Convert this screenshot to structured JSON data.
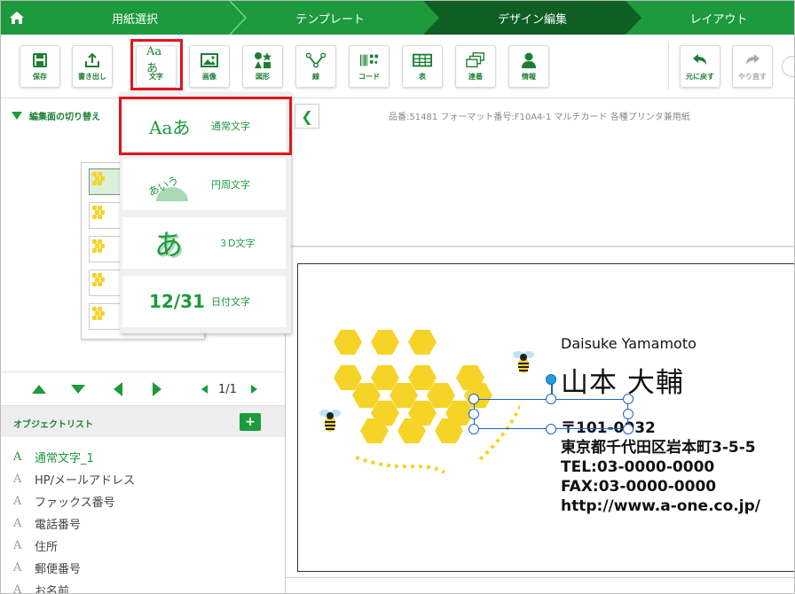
{
  "steps": [
    {
      "label": "用紙選択"
    },
    {
      "label": "テンプレート"
    },
    {
      "label": "デザイン編集"
    },
    {
      "label": "レイアウト"
    }
  ],
  "toolbar": {
    "save": "保存",
    "export": "書き出し",
    "text": "文字",
    "text_icon": "Aaあ",
    "image": "画像",
    "shape": "図形",
    "line": "線",
    "code": "コード",
    "table": "表",
    "serial": "連番",
    "info": "情報",
    "undo": "元に戻す",
    "redo": "やり直す"
  },
  "left": {
    "switch_label": "編集面の切り替え",
    "page_indicator": "1/1",
    "object_list_title": "オブジェクトリスト",
    "objects": [
      {
        "label": "通常文字_1",
        "active": true
      },
      {
        "label": "HP/メールアドレス"
      },
      {
        "label": "ファックス番号"
      },
      {
        "label": "電話番号"
      },
      {
        "label": "住所"
      },
      {
        "label": "郵便番号"
      },
      {
        "label": "お名前"
      }
    ]
  },
  "dropdown": {
    "normal": {
      "icon": "Aaあ",
      "label": "通常文字"
    },
    "circle": {
      "icon": "あいう",
      "label": "円周文字"
    },
    "threed": {
      "icon": "あ",
      "label": "３D文字"
    },
    "date": {
      "icon": "12/31",
      "label": "日付文字"
    }
  },
  "canvas": {
    "product_info": "品番:51481 フォーマット番号:F10A4-1 マルチカード 各種プリンタ兼用紙",
    "card": {
      "name_roman": "Daisuke Yamamoto",
      "name_kanji": "山本 大輔",
      "postal": "〒101-0032",
      "address": "東京都千代田区岩本町3-5-5",
      "tel": "TEL:03-0000-0000",
      "fax": "FAX:03-0000-0000",
      "url": "http://www.a-one.co.jp/"
    }
  },
  "colors": {
    "brand_green": "#1c9a3c",
    "active_step": "#0f5e24",
    "highlight_red": "#e0141e",
    "honey_yellow": "#f6d327",
    "selection_blue": "#1e64c8"
  }
}
